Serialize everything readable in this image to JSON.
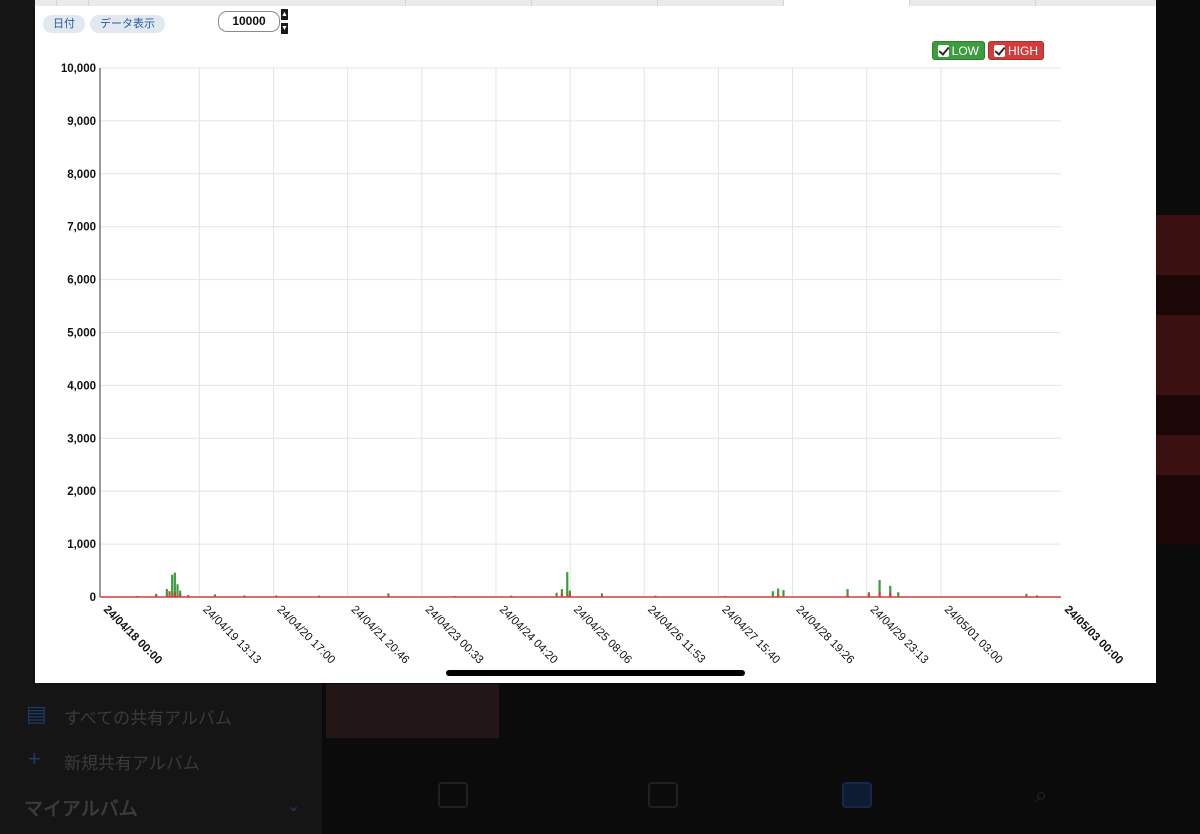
{
  "background": {
    "shared_albums_label": "すべての共有アルバム",
    "new_shared_album_label": "新規共有アルバム",
    "my_albums_label": "マイアルバム"
  },
  "controls": {
    "date_button": "日付",
    "data_display_button": "データ表示",
    "max_value": "10000"
  },
  "legend": {
    "low_label": "LOW",
    "high_label": "HIGH",
    "low_color": "#3d9c3d",
    "high_color": "#d43c3c"
  },
  "chart_data": {
    "type": "bar",
    "title": "",
    "xlabel": "",
    "ylabel": "",
    "ylim": [
      0,
      10000
    ],
    "y_ticks": [
      "0",
      "1,000",
      "2,000",
      "3,000",
      "4,000",
      "5,000",
      "6,000",
      "7,000",
      "8,000",
      "9,000",
      "10,000"
    ],
    "x_range": [
      "24/04/18 00:00",
      "24/05/03 00:00"
    ],
    "x_ticks": [
      "24/04/18 00:00",
      "24/04/19 13:13",
      "24/04/20 17:00",
      "24/04/21 20:46",
      "24/04/23 00:33",
      "24/04/24 04:20",
      "24/04/25 08:06",
      "24/04/26 11:53",
      "24/04/27 15:40",
      "24/04/28 19:26",
      "24/04/29 23:13",
      "24/05/01 03:00",
      "24/05/03 00:00"
    ],
    "grid": true,
    "series": [
      {
        "name": "LOW",
        "color": "#3d9c3d",
        "points": [
          [
            "24/04/18 14:00",
            20
          ],
          [
            "24/04/18 21:00",
            60
          ],
          [
            "24/04/19 01:00",
            150
          ],
          [
            "24/04/19 03:00",
            420
          ],
          [
            "24/04/19 04:00",
            460
          ],
          [
            "24/04/19 05:00",
            240
          ],
          [
            "24/04/19 06:00",
            120
          ],
          [
            "24/04/19 09:00",
            40
          ],
          [
            "24/04/19 19:00",
            50
          ],
          [
            "24/04/20 06:00",
            30
          ],
          [
            "24/04/20 18:00",
            30
          ],
          [
            "24/04/21 10:00",
            25
          ],
          [
            "24/04/22 12:00",
            70
          ],
          [
            "24/04/23 13:00",
            20
          ],
          [
            "24/04/24 10:00",
            25
          ],
          [
            "24/04/25 03:00",
            80
          ],
          [
            "24/04/25 05:00",
            150
          ],
          [
            "24/04/25 07:00",
            470
          ],
          [
            "24/04/25 08:00",
            120
          ],
          [
            "24/04/25 20:00",
            70
          ],
          [
            "24/04/26 16:00",
            25
          ],
          [
            "24/04/27 18:00",
            20
          ],
          [
            "24/04/28 12:00",
            110
          ],
          [
            "24/04/28 14:00",
            160
          ],
          [
            "24/04/28 16:00",
            130
          ],
          [
            "24/04/29 16:00",
            150
          ],
          [
            "24/04/30 00:00",
            90
          ],
          [
            "24/04/30 04:00",
            320
          ],
          [
            "24/04/30 08:00",
            210
          ],
          [
            "24/04/30 11:00",
            90
          ],
          [
            "24/05/02 11:00",
            60
          ],
          [
            "24/05/02 15:00",
            30
          ]
        ]
      },
      {
        "name": "HIGH",
        "color": "#d43c3c",
        "points": [
          [
            "24/04/18 21:00",
            30
          ],
          [
            "24/04/19 02:00",
            110
          ],
          [
            "24/04/19 04:00",
            90
          ],
          [
            "24/04/19 06:00",
            50
          ],
          [
            "24/04/22 12:00",
            20
          ],
          [
            "24/04/25 05:00",
            60
          ],
          [
            "24/04/25 08:00",
            70
          ],
          [
            "24/04/28 14:00",
            40
          ],
          [
            "24/04/29 16:00",
            40
          ],
          [
            "24/04/30 00:00",
            50
          ],
          [
            "24/04/30 04:00",
            90
          ],
          [
            "24/04/30 08:00",
            80
          ],
          [
            "24/05/02 11:00",
            20
          ]
        ]
      }
    ]
  }
}
